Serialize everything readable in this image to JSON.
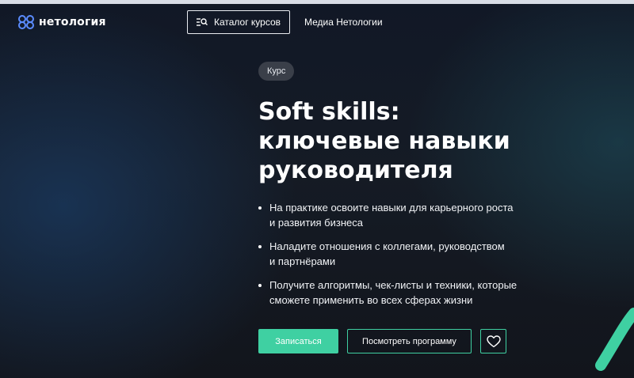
{
  "header": {
    "logo_text": "нетология",
    "catalog_label": "Каталог курсов",
    "media_label": "Медиа Нетологии"
  },
  "hero": {
    "badge": "Курс",
    "title_line1": "Soft skills:",
    "title_line2": "ключевые навыки",
    "title_line3": "руководителя",
    "bullets": [
      {
        "line1": "На практике освоите навыки для карьерного роста",
        "line2": "и развития бизнеса"
      },
      {
        "line1": "Наладите отношения с коллегами, руководством",
        "line2": "и партнёрами"
      },
      {
        "line1": "Получите алгоритмы, чек-листы и техники, которые",
        "line2": "сможете применить во всех сферах жизни"
      }
    ],
    "enroll_label": "Записаться",
    "program_label": "Посмотреть программу"
  },
  "colors": {
    "accent": "#3fd0a2",
    "logo_blue": "#5b8cff"
  },
  "icons": {
    "logo": "netology-logo-icon",
    "catalog": "search-list-icon",
    "favorite": "heart-icon"
  }
}
